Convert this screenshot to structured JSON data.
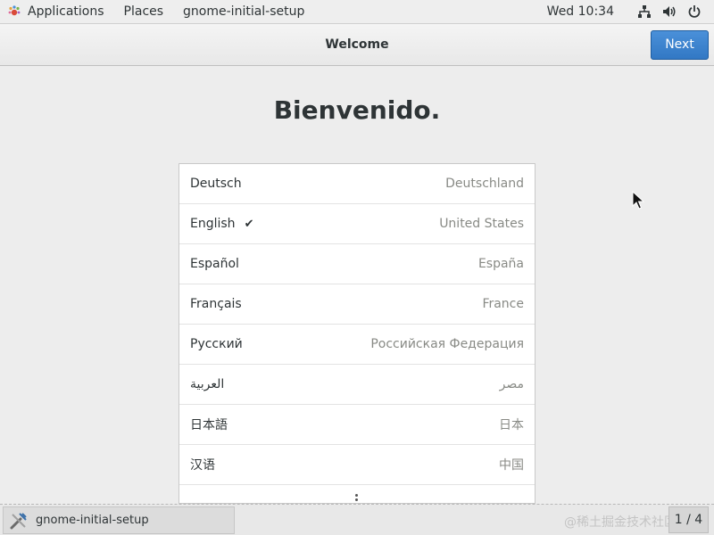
{
  "topbar": {
    "applications": "Applications",
    "places": "Places",
    "app_name": "gnome-initial-setup",
    "clock": "Wed 10:34",
    "tray_icons": [
      "network-icon",
      "volume-icon",
      "power-icon"
    ]
  },
  "header": {
    "title": "Welcome",
    "next_label": "Next"
  },
  "main": {
    "heading": "Bienvenido.",
    "languages": [
      {
        "name": "Deutsch",
        "region": "Deutschland",
        "selected": false
      },
      {
        "name": "English",
        "region": "United States",
        "selected": true
      },
      {
        "name": "Español",
        "region": "España",
        "selected": false
      },
      {
        "name": "Français",
        "region": "France",
        "selected": false
      },
      {
        "name": "Русский",
        "region": "Российская Федерация",
        "selected": false
      },
      {
        "name": "العربية",
        "region": "مصر",
        "selected": false
      },
      {
        "name": "日本語",
        "region": "日本",
        "selected": false
      },
      {
        "name": "汉语",
        "region": "中国",
        "selected": false
      }
    ],
    "check_glyph": "✔"
  },
  "taskbar": {
    "task_label": "gnome-initial-setup",
    "watermark": "@稀土掘金技术社区",
    "workspace": "1 / 4"
  },
  "colors": {
    "accent": "#4a90d9",
    "region_text": "#888a85"
  }
}
